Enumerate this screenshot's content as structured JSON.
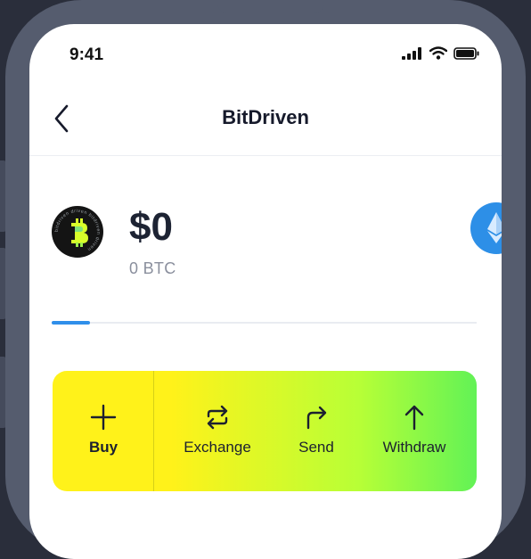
{
  "status_bar": {
    "time": "9:41"
  },
  "nav": {
    "title": "BitDriven"
  },
  "wallet": {
    "balance": "$0",
    "crypto_balance": "0 BTC",
    "coin_logo_text": "bitdriven driven bitdriven driven",
    "next_coin_icon": "ethereum-icon"
  },
  "actions": [
    {
      "label": "Buy",
      "icon": "plus-icon"
    },
    {
      "label": "Exchange",
      "icon": "exchange-arrows-icon"
    },
    {
      "label": "Send",
      "icon": "send-arrow-icon"
    },
    {
      "label": "Withdraw",
      "icon": "arrow-up-icon"
    }
  ],
  "colors": {
    "background": "#2a2e3b",
    "frame": "#555c6e",
    "accent": "#2f8fea",
    "gradient_start": "#fff21a",
    "gradient_end": "#62f256",
    "text_primary": "#1d2333",
    "text_secondary": "#8a8f9d"
  }
}
